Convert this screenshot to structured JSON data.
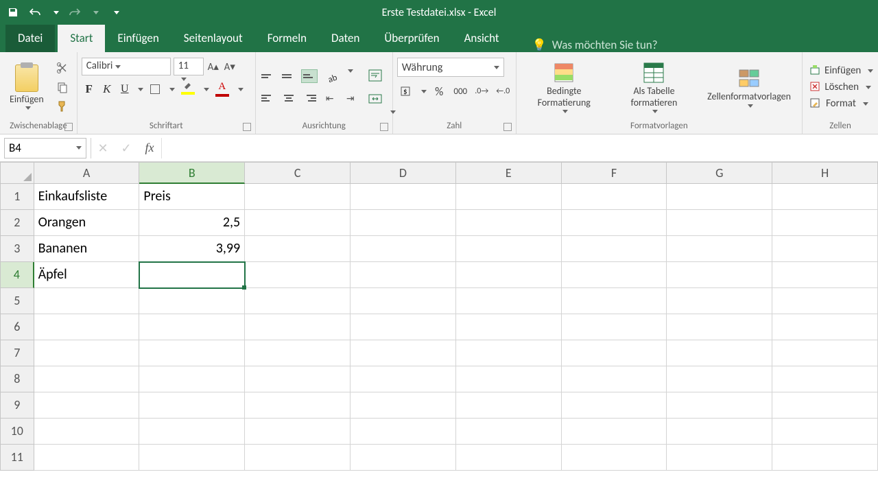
{
  "window": {
    "title": "Erste Testdatei.xlsx - Excel"
  },
  "qat": {
    "save": "save-icon",
    "undo": "undo-icon",
    "redo": "redo-icon"
  },
  "tabs": {
    "file": "Datei",
    "items": [
      "Start",
      "Einfügen",
      "Seitenlayout",
      "Formeln",
      "Daten",
      "Überprüfen",
      "Ansicht"
    ],
    "active": "Start",
    "tell_me": "Was möchten Sie tun?"
  },
  "ribbon": {
    "clipboard": {
      "paste": "Einfügen",
      "label": "Zwischenablage"
    },
    "font": {
      "name": "Calibri",
      "size": "11",
      "label": "Schriftart",
      "bold": "F",
      "italic": "K",
      "underline": "U"
    },
    "alignment": {
      "label": "Ausrichtung"
    },
    "number": {
      "format": "Währung",
      "label": "Zahl",
      "percent": "%",
      "thousands": "000"
    },
    "styles": {
      "conditional": "Bedingte Formatierung",
      "table": "Als Tabelle formatieren",
      "cell_styles": "Zellenformatvorlagen",
      "label": "Formatvorlagen"
    },
    "cells": {
      "insert": "Einfügen",
      "delete": "Löschen",
      "format": "Format",
      "label": "Zellen"
    }
  },
  "formula_bar": {
    "name_box": "B4",
    "formula": ""
  },
  "grid": {
    "columns": [
      "A",
      "B",
      "C",
      "D",
      "E",
      "F",
      "G",
      "H"
    ],
    "active_col": "B",
    "active_row": 4,
    "selected_cell": "B4",
    "rows": [
      {
        "n": 1,
        "A": "Einkaufsliste",
        "B": "Preis"
      },
      {
        "n": 2,
        "A": "Orangen",
        "B": "2,5"
      },
      {
        "n": 3,
        "A": "Bananen",
        "B": "3,99"
      },
      {
        "n": 4,
        "A": "Äpfel",
        "B": ""
      },
      {
        "n": 5
      },
      {
        "n": 6
      },
      {
        "n": 7
      },
      {
        "n": 8
      },
      {
        "n": 9
      },
      {
        "n": 10
      },
      {
        "n": 11
      }
    ]
  },
  "chart_data": {
    "type": "table",
    "title": "Einkaufsliste",
    "columns": [
      "Einkaufsliste",
      "Preis"
    ],
    "rows": [
      [
        "Orangen",
        2.5
      ],
      [
        "Bananen",
        3.99
      ],
      [
        "Äpfel",
        null
      ]
    ]
  }
}
